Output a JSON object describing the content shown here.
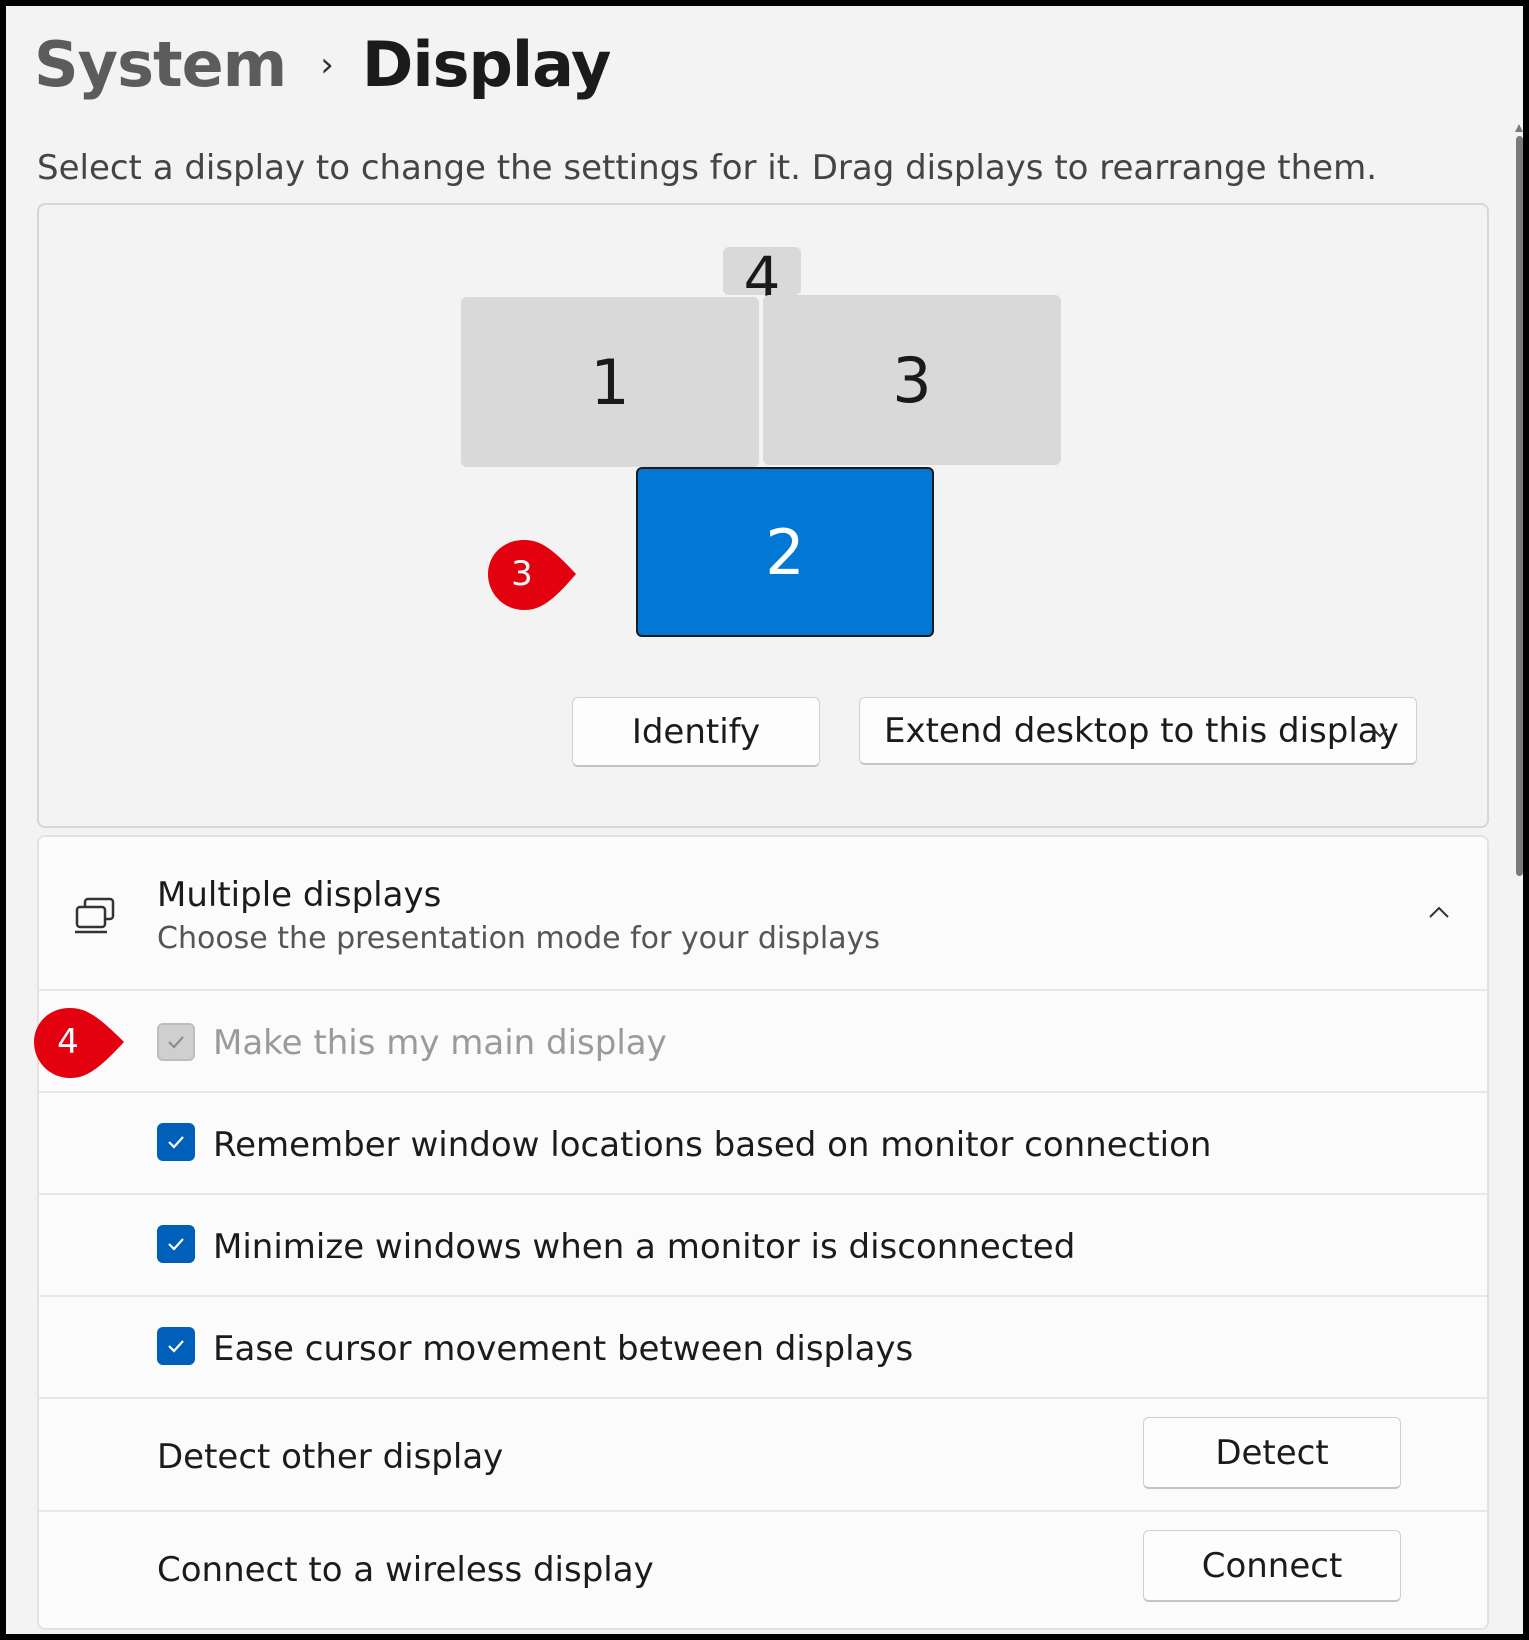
{
  "breadcrumb": {
    "parent": "System",
    "separator": "›",
    "current": "Display"
  },
  "instructions": "Select a display to change the settings for it. Drag displays to rearrange them.",
  "monitors": [
    {
      "label": "4",
      "selected": false
    },
    {
      "label": "1",
      "selected": false
    },
    {
      "label": "3",
      "selected": false
    },
    {
      "label": "2",
      "selected": true
    }
  ],
  "arrangement_actions": {
    "identify_label": "Identify",
    "mode_value": "Extend desktop to this display"
  },
  "multiple_displays": {
    "icon": "multiple-displays-icon",
    "title": "Multiple displays",
    "subtitle": "Choose the presentation mode for your displays",
    "options": [
      {
        "label": "Make this my main display",
        "checked": true,
        "disabled": true
      },
      {
        "label": "Remember window locations based on monitor connection",
        "checked": true,
        "disabled": false
      },
      {
        "label": "Minimize windows when a monitor is disconnected",
        "checked": true,
        "disabled": false
      },
      {
        "label": "Ease cursor movement between displays",
        "checked": true,
        "disabled": false
      }
    ],
    "detect": {
      "label": "Detect other display",
      "button": "Detect"
    },
    "wireless": {
      "label": "Connect to a wireless display",
      "button": "Connect"
    }
  },
  "callouts": [
    {
      "number": "3"
    },
    {
      "number": "4"
    }
  ],
  "colors": {
    "accent": "#0078d4",
    "checkbox": "#005fb8",
    "callout": "#e3000f"
  }
}
